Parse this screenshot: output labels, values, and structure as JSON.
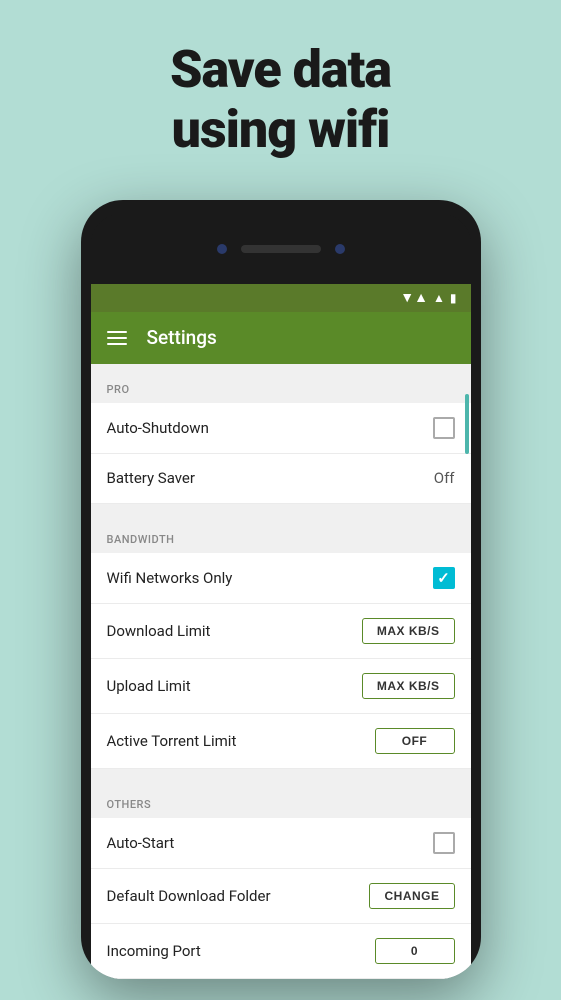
{
  "headline": {
    "line1": "Save data",
    "line2": "using wifi"
  },
  "toolbar": {
    "title": "Settings"
  },
  "sections": {
    "pro": {
      "label": "PRO",
      "items": [
        {
          "label": "Auto-Shutdown",
          "control": "checkbox",
          "value": false
        },
        {
          "label": "Battery Saver",
          "control": "text",
          "value": "Off"
        }
      ]
    },
    "bandwidth": {
      "label": "BANDWIDTH",
      "items": [
        {
          "label": "Wifi Networks Only",
          "control": "checkbox_checked",
          "value": true
        },
        {
          "label": "Download Limit",
          "control": "button",
          "value": "MAX KB/S"
        },
        {
          "label": "Upload Limit",
          "control": "button",
          "value": "MAX KB/S"
        },
        {
          "label": "Active Torrent Limit",
          "control": "button",
          "value": "OFF"
        }
      ]
    },
    "others": {
      "label": "OTHERS",
      "items": [
        {
          "label": "Auto-Start",
          "control": "checkbox",
          "value": false
        },
        {
          "label": "Default Download Folder",
          "control": "button",
          "value": "CHANGE"
        },
        {
          "label": "Incoming Port",
          "control": "button",
          "value": "0"
        }
      ]
    }
  },
  "status": {
    "wifi": "▼▲",
    "signal": "▲",
    "battery": "▮"
  }
}
